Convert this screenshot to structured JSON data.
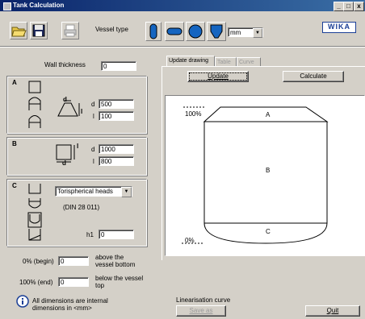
{
  "window": {
    "title": "Tank Calculation",
    "min": "_",
    "max": "□",
    "close": "x"
  },
  "toolbar": {
    "vessel_type_label": "Vessel type",
    "unit": "mm",
    "logo": "WIKA"
  },
  "left": {
    "wall_thickness_label": "Wall thickness",
    "wall_thickness_value": "0",
    "section_a": {
      "label": "A",
      "d_label": "d",
      "d_value": "500",
      "l_label": "l",
      "l_value": "100",
      "dim_d": "d",
      "dim_l": "l"
    },
    "section_b": {
      "label": "B",
      "d_label": "d",
      "d_value": "1000",
      "l_label": "l",
      "l_value": "800",
      "dim_d": "d",
      "dim_l": "l"
    },
    "section_c": {
      "label": "C",
      "head_type": "Torispherical heads",
      "standard": "(DIN 28 011)",
      "h1_label": "h1",
      "h1_value": "0"
    },
    "begin_label": "0% (begin)",
    "begin_value": "0",
    "begin_desc": "above the vessel bottom",
    "end_label": "100% (end)",
    "end_value": "0",
    "end_desc": "below the vessel top",
    "info_text": "All dimensions are internal dimensions in <mm>"
  },
  "right": {
    "tabs": [
      "Update drawing",
      "Table",
      "Curve"
    ],
    "update_button": "Update",
    "calculate_button": "Calculate",
    "drawing": {
      "top_label": "100%",
      "bottom_label": "0%",
      "section_a": "A",
      "section_b": "B",
      "section_c": "C"
    },
    "linearisation_label": "Linearisation curve",
    "save_as_button": "Save as",
    "quit_button": "Quit"
  }
}
